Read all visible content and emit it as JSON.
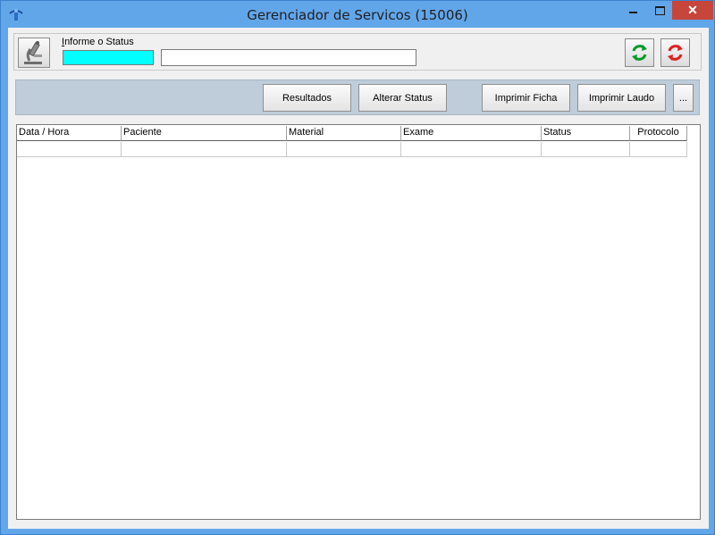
{
  "window": {
    "title": "Gerenciador de Servicos (15006)",
    "close_glyph": "✕"
  },
  "status_panel": {
    "label_prefix": "I",
    "label_rest": "nforme o Status",
    "status_color": "#00ffff",
    "status_text_value": ""
  },
  "toolbar": {
    "resultados": "Resultados",
    "alterar_status": "Alterar Status",
    "imprimir_ficha": "Imprimir Ficha",
    "imprimir_laudo": "Imprimir Laudo",
    "more": "..."
  },
  "grid": {
    "columns": [
      "Data / Hora",
      "Paciente",
      "Material",
      "Exame",
      "Status",
      "Protocolo"
    ]
  },
  "icons": {
    "app": "app-icon",
    "microscope": "microscope-icon",
    "refresh_green": "refresh-green-icon",
    "refresh_red": "refresh-red-icon"
  }
}
